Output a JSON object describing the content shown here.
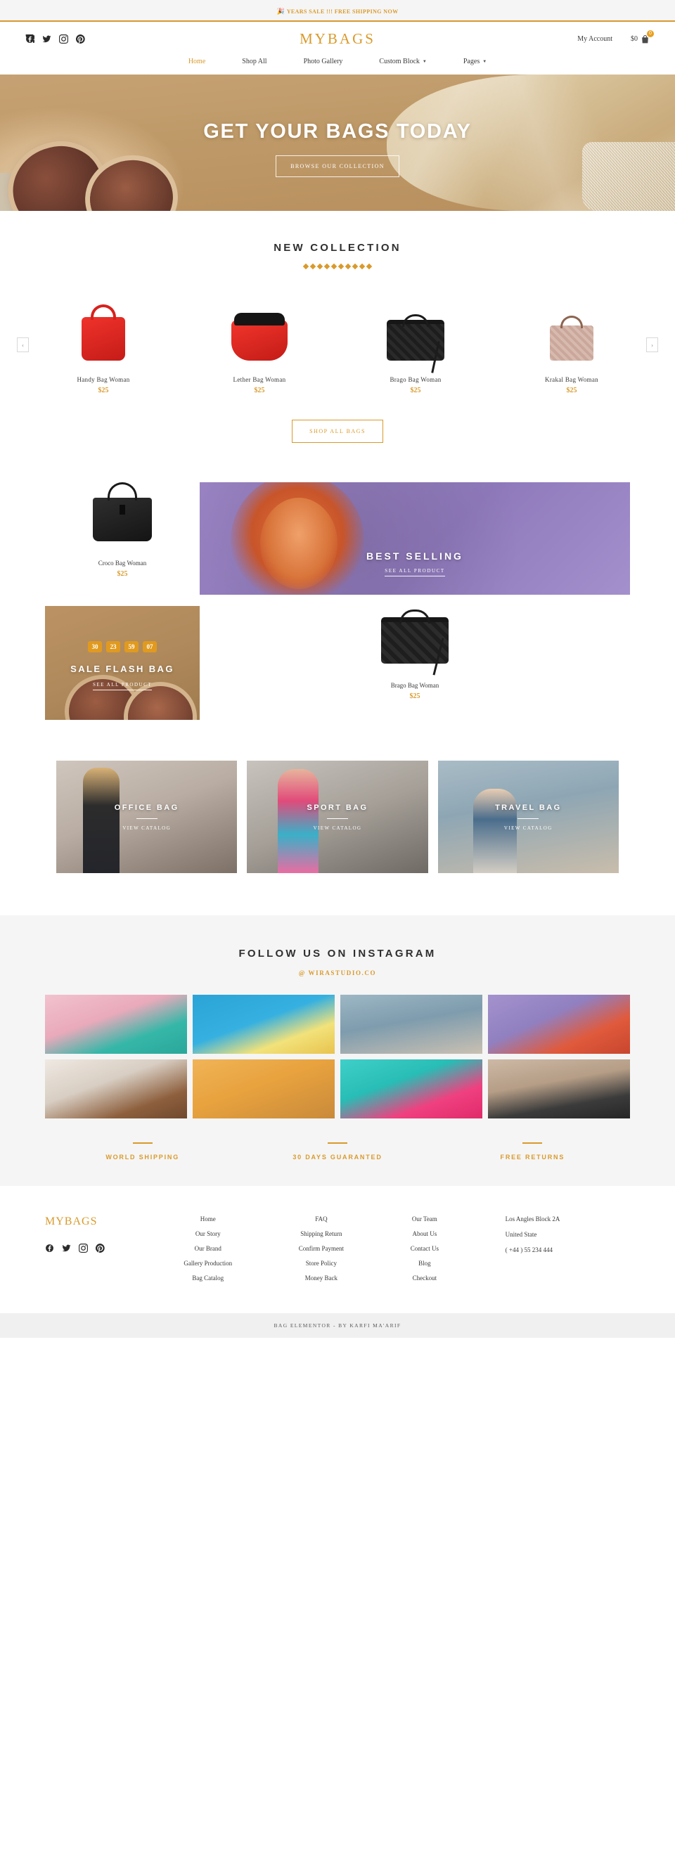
{
  "announcement": {
    "emoji": "🎉",
    "text": "YEARS SALE !!! FREE SHIPPING NOW"
  },
  "header": {
    "brand": "MYBAGS",
    "socials": [
      "facebook-icon",
      "twitter-icon",
      "instagram-icon",
      "pinterest-icon"
    ],
    "my_account": "My Account",
    "cart_total": "$0",
    "cart_count": "0"
  },
  "nav": [
    {
      "label": "Home",
      "active": true,
      "caret": ""
    },
    {
      "label": "Shop All",
      "active": false,
      "caret": ""
    },
    {
      "label": "Photo Gallery",
      "active": false,
      "caret": ""
    },
    {
      "label": "Custom Block",
      "active": false,
      "caret": "▼"
    },
    {
      "label": "Pages",
      "active": false,
      "caret": "▼"
    }
  ],
  "hero": {
    "title": "GET YOUR BAGS TODAY",
    "button": "BROWSE OUR COLLECTION"
  },
  "new_collection": {
    "title": "NEW COLLECTION",
    "prev": "‹",
    "next": "›",
    "shop_all": "SHOP ALL BAGS",
    "products": [
      {
        "name": "Handy Bag Woman",
        "price": "$25"
      },
      {
        "name": "Lether Bag Woman",
        "price": "$25"
      },
      {
        "name": "Brago Bag Woman",
        "price": "$25"
      },
      {
        "name": "Krakal Bag Woman",
        "price": "$25"
      }
    ]
  },
  "features": {
    "croco": {
      "name": "Croco Bag Woman",
      "price": "$25"
    },
    "best_selling": {
      "title": "BEST SELLING",
      "link": "SEE ALL PRODUCT"
    },
    "sale_flash": {
      "title": "SALE FLASH BAG",
      "link": "SEE ALL PRODUCT",
      "countdown": [
        "30",
        "23",
        "59",
        "07"
      ]
    },
    "brago": {
      "name": "Brago Bag Woman",
      "price": "$25"
    }
  },
  "categories": [
    {
      "title": "OFFICE BAG",
      "link": "VIEW CATALOG"
    },
    {
      "title": "SPORT BAG",
      "link": "VIEW CATALOG"
    },
    {
      "title": "TRAVEL BAG",
      "link": "VIEW CATALOG"
    }
  ],
  "instagram": {
    "title": "FOLLOW US ON INSTAGRAM",
    "handle": "@ WIRASTUDIO.CO",
    "tiles": [
      "ig1",
      "ig2",
      "ig3",
      "ig4",
      "ig5",
      "ig6",
      "ig7",
      "ig8"
    ]
  },
  "usps": [
    "WORLD SHIPPING",
    "30 DAYS GUARANTED",
    "FREE RETURNS"
  ],
  "footer": {
    "logo": "MYBAGS",
    "socials": [
      "facebook-icon",
      "twitter-icon",
      "instagram-icon",
      "pinterest-icon"
    ],
    "col1": [
      "Home",
      "Our Story",
      "Our Brand",
      "Gallery Production",
      "Bag Catalog"
    ],
    "col2": [
      "FAQ",
      "Shipping Return",
      "Confirm Payment",
      "Store Policy",
      "Money Back"
    ],
    "col3": [
      "Our Team",
      "About Us",
      "Contact Us",
      "Blog",
      "Checkout"
    ],
    "address": [
      "Los Angles Block 2A",
      "United State",
      "( +44 ) 55 234 444"
    ]
  },
  "copyright": "BAG ELEMENTOR - BY KARFI MA'ARIF",
  "colors": {
    "accent": "#d99a2b",
    "badge": "#e8a020",
    "hero_bg": "#b08a5c"
  }
}
